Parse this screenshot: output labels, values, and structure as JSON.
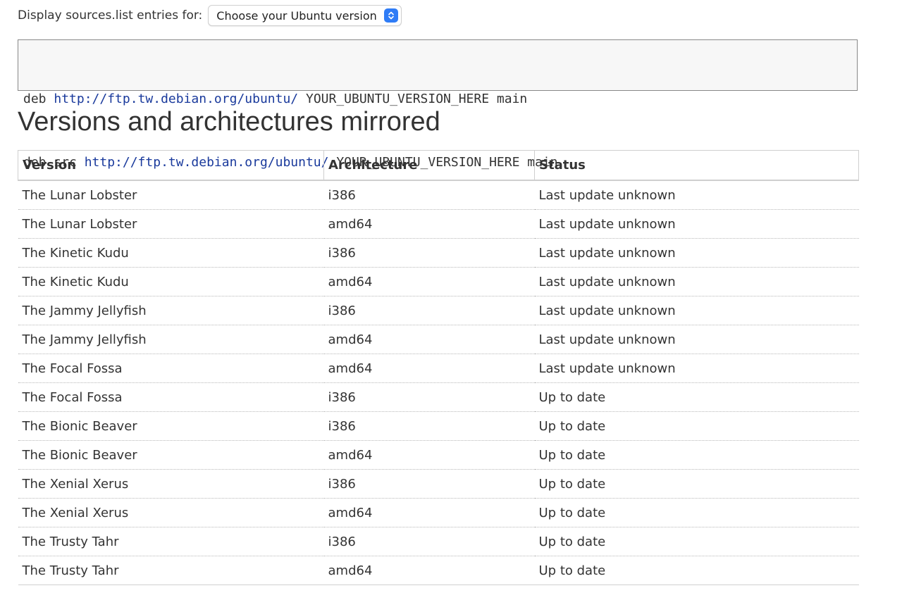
{
  "selector": {
    "label": "Display sources.list entries for:",
    "selected": "Choose your Ubuntu version"
  },
  "sources": [
    {
      "type": "deb",
      "url": "http://ftp.tw.debian.org/ubuntu/",
      "rest": "YOUR_UBUNTU_VERSION_HERE main"
    },
    {
      "type": "deb-src",
      "url": "http://ftp.tw.debian.org/ubuntu/",
      "rest": "YOUR_UBUNTU_VERSION_HERE main"
    }
  ],
  "section_title": "Versions and architectures mirrored",
  "table": {
    "headers": [
      "Version",
      "Architecture",
      "Status"
    ],
    "rows": [
      {
        "version": "The Lunar Lobster",
        "arch": "i386",
        "status": "Last update unknown",
        "state": "unknown"
      },
      {
        "version": "The Lunar Lobster",
        "arch": "amd64",
        "status": "Last update unknown",
        "state": "unknown"
      },
      {
        "version": "The Kinetic Kudu",
        "arch": "i386",
        "status": "Last update unknown",
        "state": "unknown"
      },
      {
        "version": "The Kinetic Kudu",
        "arch": "amd64",
        "status": "Last update unknown",
        "state": "unknown"
      },
      {
        "version": "The Jammy Jellyfish",
        "arch": "i386",
        "status": "Last update unknown",
        "state": "unknown"
      },
      {
        "version": "The Jammy Jellyfish",
        "arch": "amd64",
        "status": "Last update unknown",
        "state": "unknown"
      },
      {
        "version": "The Focal Fossa",
        "arch": "amd64",
        "status": "Last update unknown",
        "state": "unknown"
      },
      {
        "version": "The Focal Fossa",
        "arch": "i386",
        "status": "Up to date",
        "state": "ok"
      },
      {
        "version": "The Bionic Beaver",
        "arch": "i386",
        "status": "Up to date",
        "state": "ok"
      },
      {
        "version": "The Bionic Beaver",
        "arch": "amd64",
        "status": "Up to date",
        "state": "ok"
      },
      {
        "version": "The Xenial Xerus",
        "arch": "i386",
        "status": "Up to date",
        "state": "ok"
      },
      {
        "version": "The Xenial Xerus",
        "arch": "amd64",
        "status": "Up to date",
        "state": "ok"
      },
      {
        "version": "The Trusty Tahr",
        "arch": "i386",
        "status": "Up to date",
        "state": "ok"
      },
      {
        "version": "The Trusty Tahr",
        "arch": "amd64",
        "status": "Up to date",
        "state": "ok"
      }
    ]
  },
  "colors": {
    "status_ok": "#1a8a1a",
    "status_unknown": "#666666",
    "link": "#1a3a9c",
    "select_accent": "#2f7cf6"
  },
  "icons": {
    "select_arrows": "chevron-up-down-icon"
  }
}
